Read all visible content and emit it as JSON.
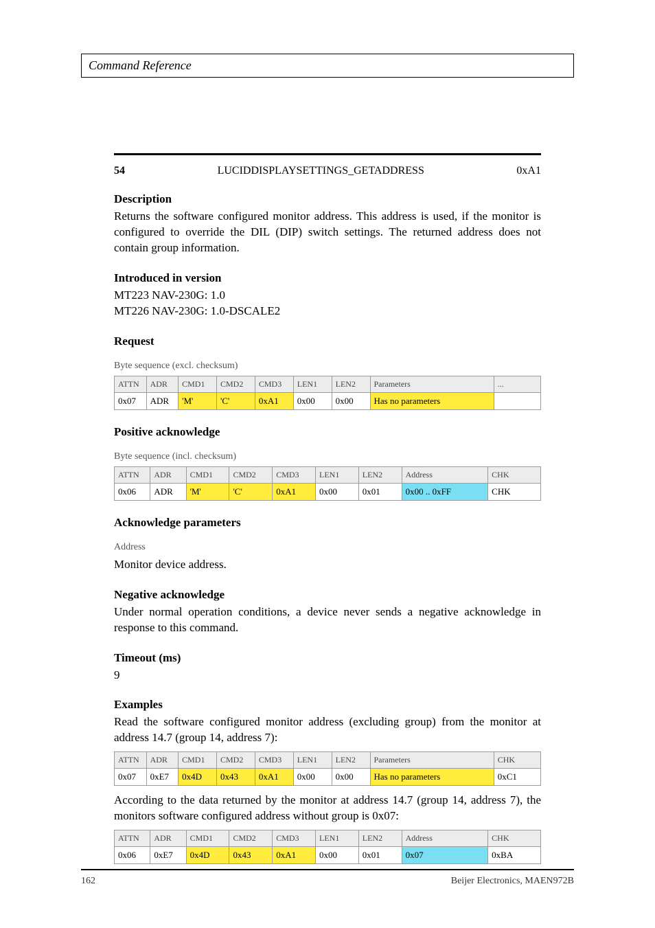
{
  "header": {
    "title": "Command Reference"
  },
  "section": {
    "number": "54",
    "name": "LUCIDDISPLAYSETTINGS_GETADDRESS",
    "hex": "0xA1"
  },
  "description": {
    "heading": "Description",
    "text": "Returns the software configured monitor address. This address is used, if the monitor is configured to override the DIL (DIP) switch settings. The returned address does not contain group information."
  },
  "introduced": {
    "heading": "Introduced in version",
    "lines": [
      "MT223 NAV-230G: 1.0",
      "MT226 NAV-230G: 1.0-DSCALE2"
    ]
  },
  "request": {
    "heading": "Request",
    "label": "Byte sequence (excl. checksum)",
    "headers": [
      "ATTN",
      "ADR",
      "CMD1",
      "CMD2",
      "CMD3",
      "LEN1",
      "LEN2",
      "Parameters",
      "..."
    ],
    "cells": [
      "0x07",
      "ADR",
      "'M'",
      "'C'",
      "0xA1",
      "0x00",
      "0x00",
      "Has no parameters",
      ""
    ]
  },
  "pos_ack": {
    "heading": "Positive acknowledge",
    "label": "Byte sequence (incl. checksum)",
    "headers": [
      "ATTN",
      "ADR",
      "CMD1",
      "CMD2",
      "CMD3",
      "LEN1",
      "LEN2",
      "Address",
      "CHK"
    ],
    "cells": [
      "0x06",
      "ADR",
      "'M'",
      "'C'",
      "0xA1",
      "0x00",
      "0x01",
      "0x00 .. 0xFF",
      "CHK"
    ]
  },
  "ack_params": {
    "heading": "Acknowledge parameters",
    "label": "Address",
    "text": "Monitor device address."
  },
  "neg_ack": {
    "heading": "Negative acknowledge",
    "text": "Under normal operation conditions, a device never sends a negative acknowledge in response to this command."
  },
  "timeout": {
    "heading": "Timeout (ms)",
    "value": "9"
  },
  "examples": {
    "heading": "Examples",
    "req_text": "Read the software configured monitor address (excluding group) from the monitor at address 14.7 (group 14, address 7):",
    "req_headers": [
      "ATTN",
      "ADR",
      "CMD1",
      "CMD2",
      "CMD3",
      "LEN1",
      "LEN2",
      "Parameters",
      "CHK"
    ],
    "req_cells": [
      "0x07",
      "0xE7",
      "0x4D",
      "0x43",
      "0xA1",
      "0x00",
      "0x00",
      "Has no parameters",
      "0xC1"
    ],
    "ack_text": "According to the data returned by the monitor at address 14.7 (group 14, address 7), the monitors software configured address without group is 0x07:",
    "ack_headers": [
      "ATTN",
      "ADR",
      "CMD1",
      "CMD2",
      "CMD3",
      "LEN1",
      "LEN2",
      "Address",
      "CHK"
    ],
    "ack_cells": [
      "0x06",
      "0xE7",
      "0x4D",
      "0x43",
      "0xA1",
      "0x00",
      "0x01",
      "0x07",
      "0xBA"
    ]
  },
  "footer": {
    "page": "162",
    "doc": "Beijer Electronics, MAEN972B"
  }
}
